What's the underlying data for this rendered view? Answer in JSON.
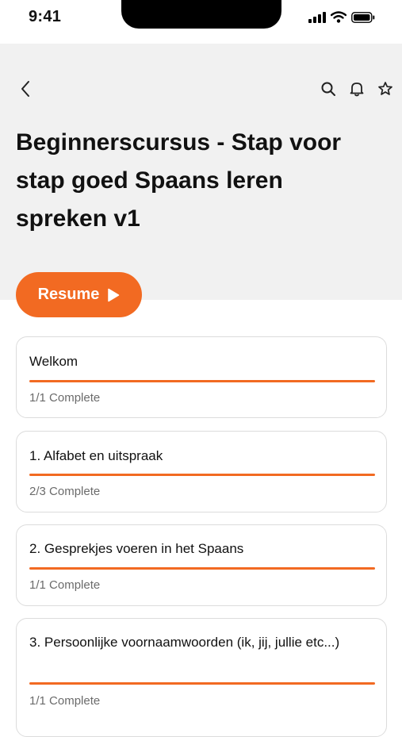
{
  "status_bar": {
    "time": "9:41"
  },
  "header": {
    "title": "Beginnerscursus - Stap voor stap goed Spaans leren spreken v1",
    "icons": [
      "back-icon",
      "search-icon",
      "bell-icon",
      "star-icon"
    ]
  },
  "resume_button": {
    "label": "Resume"
  },
  "modules": [
    {
      "title": "Welkom",
      "status": "1/1 Complete",
      "progress": 1.0
    },
    {
      "title": "1. Alfabet en uitspraak",
      "status": "2/3 Complete",
      "progress": 1.0
    },
    {
      "title": "2. Gesprekjes voeren in het Spaans",
      "status": "1/1 Complete",
      "progress": 1.0
    },
    {
      "title": "3. Persoonlijke voornaamwoorden (ik, jij, jullie etc...)",
      "status": "1/1 Complete",
      "progress": 1.0
    }
  ],
  "colors": {
    "accent": "#f26a22",
    "header_bg": "#f1f1f1",
    "card_border": "#dcdcdc"
  }
}
